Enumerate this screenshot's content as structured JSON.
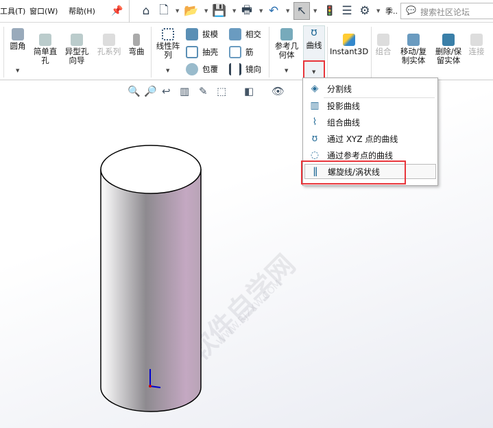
{
  "menubar": {
    "items": [
      "工具(T)",
      "窗口(W)",
      "帮助(H)"
    ],
    "search_placeholder": "搜索社区论坛",
    "more": "季.."
  },
  "ribbon": {
    "fillet": "圆角",
    "simple_hole": "简单直孔",
    "hole_wizard": "异型孔向导",
    "hole_series": "孔系列",
    "flex": "弯曲",
    "linear_pattern": "线性阵列",
    "draft": "拔模",
    "shell": "抽壳",
    "wrap": "包覆",
    "intersect": "相交",
    "rib": "筋",
    "mirror": "镜向",
    "ref_geometry": "参考几何体",
    "curves": "曲线",
    "instant3d": "Instant3D",
    "combine": "组合",
    "move_copy": "移动/复制实体",
    "delete_keep": "删除/保留实体",
    "join": "连接"
  },
  "curves_menu": {
    "items": [
      "分割线",
      "投影曲线",
      "组合曲线",
      "通过 XYZ 点的曲线",
      "通过参考点的曲线",
      "螺旋线/涡状线"
    ],
    "highlighted": "螺旋线/涡状线"
  },
  "watermark": {
    "text": "软件自学网",
    "url": "WWW.RJZXW.COM"
  },
  "colors": {
    "highlight_red": "#e8343a",
    "icon_blue": "#2a6f9a"
  }
}
